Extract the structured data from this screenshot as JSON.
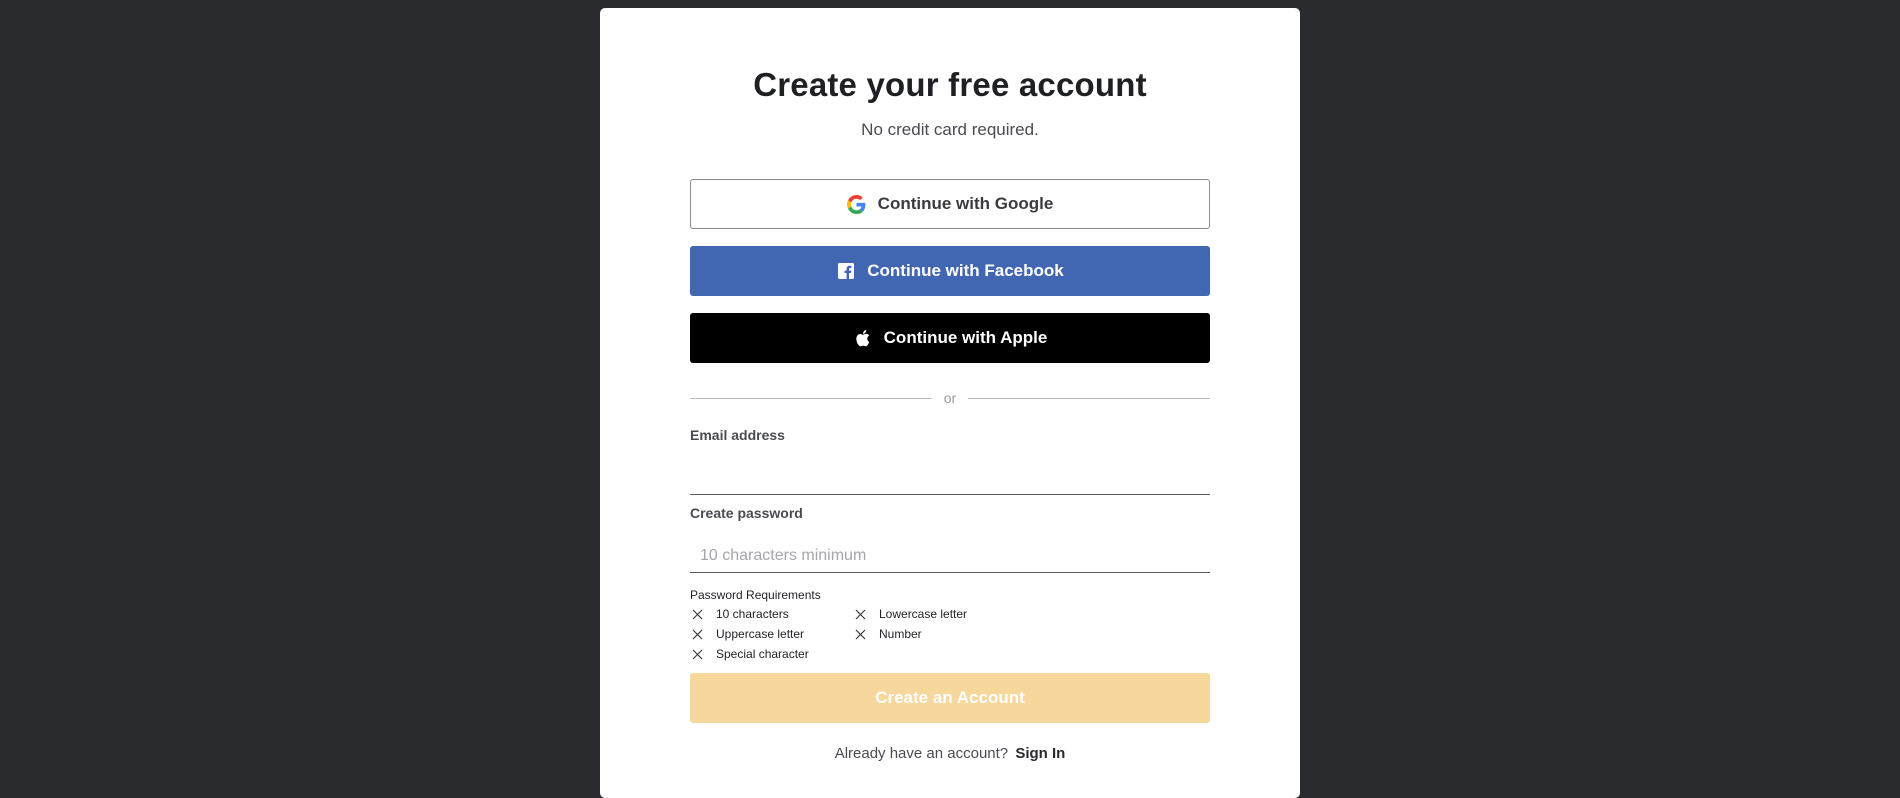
{
  "page": {
    "title": "Create your free account",
    "subtitle": "No credit card required."
  },
  "sso": {
    "google_label": "Continue with Google",
    "facebook_label": "Continue with Facebook",
    "apple_label": "Continue with Apple",
    "google_icon": "google-g-icon",
    "facebook_icon": "facebook-f-icon",
    "apple_icon": "apple-logo-icon"
  },
  "divider": {
    "label": "or"
  },
  "form": {
    "email_label": "Email address",
    "email_value": "",
    "password_label": "Create password",
    "password_placeholder": "10 characters minimum",
    "password_value": ""
  },
  "requirements": {
    "title": "Password Requirements",
    "items": [
      {
        "label": "10 characters",
        "met": false
      },
      {
        "label": "Lowercase letter",
        "met": false
      },
      {
        "label": "Uppercase letter",
        "met": false
      },
      {
        "label": "Number",
        "met": false
      },
      {
        "label": "Special character",
        "met": false
      }
    ]
  },
  "submit": {
    "label": "Create an Account",
    "enabled": false
  },
  "footer": {
    "prompt": "Already have an account?",
    "signin_label": "Sign In"
  },
  "colors": {
    "background": "#2a2b2f",
    "facebook": "#4267b2",
    "apple": "#000000",
    "submit_disabled": "#f6d79c"
  }
}
